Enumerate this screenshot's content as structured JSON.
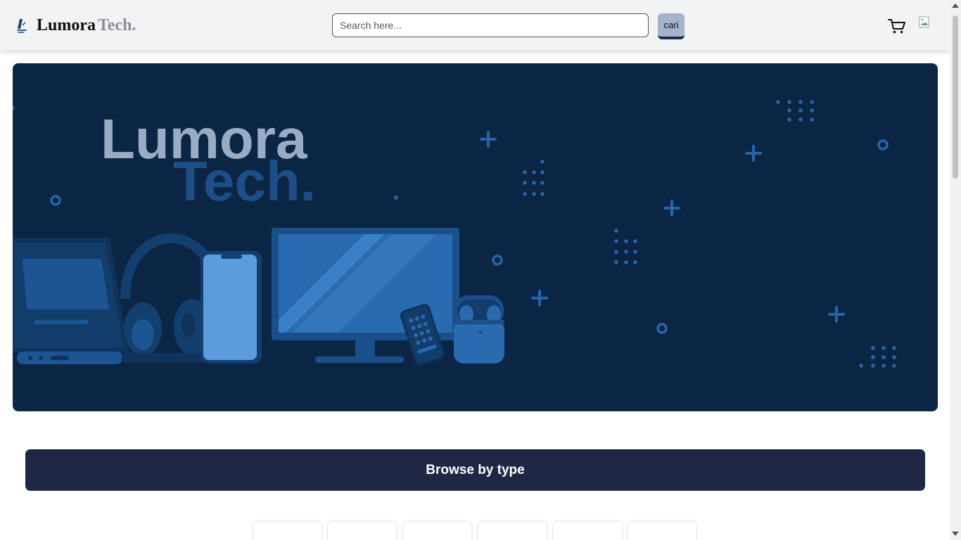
{
  "navbar": {
    "brand_primary": "Lumora",
    "brand_secondary": "Tech.",
    "brand_icon": "brand-logo-icon",
    "search": {
      "placeholder": "Search here...",
      "value": ""
    },
    "search_button_label": "cari",
    "cart_icon": "cart-icon",
    "avatar_icon": "broken-image-icon"
  },
  "hero": {
    "title_primary": "Lumora",
    "title_secondary": "Tech.",
    "background_color": "#0b2545"
  },
  "browse": {
    "title": "Browse by type",
    "cards": [
      "",
      "",
      "",
      "",
      "",
      ""
    ]
  },
  "colors": {
    "navbar_bg": "#f2f3f5",
    "accent_button": "#a3b3cc",
    "browse_bg": "#1f2744"
  }
}
